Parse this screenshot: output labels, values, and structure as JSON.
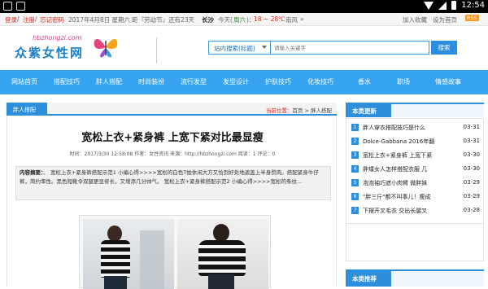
{
  "statusbar": {
    "time": "12:54"
  },
  "topbar": {
    "login": "登录",
    "sep1": " / ",
    "register": "注册",
    "sep2": " / ",
    "forgot": "忘记密码",
    "date": "2017年4月8日 星期六",
    "holiday_prefix": "距『劳动节』还有23天",
    "city": "长沙",
    "weather_today": "今天(",
    "weather_desc": "周六",
    "weather_close": ")：",
    "temp": "18 ~ 28℃",
    "wind": "南风",
    "more": "»",
    "add_fav": "加入收藏",
    "set_home": "设为首页",
    "rss": "RSS"
  },
  "header": {
    "logo_text": "众紫女性网",
    "logo_url": "hbzhongzi.com",
    "search_scope": "站内搜索(标题)",
    "search_placeholder": "请输入关键字",
    "search_button": "搜索"
  },
  "nav": {
    "items": [
      "网站首页",
      "搭配技巧",
      "胖人搭配",
      "时尚装扮",
      "流行发型",
      "发型设计",
      "护肤技巧",
      "化妆技巧",
      "香水",
      "职场",
      "情感故事"
    ]
  },
  "breadcrumb": {
    "tab": "胖人搭配",
    "label": "当前位置：",
    "path": "首页 > 胖人搭配"
  },
  "article": {
    "title": "宽松上衣+紧身裤 上宽下紧对比最显瘦",
    "meta": "时间：2017/3/30 12:58:08  作者：女性资讯  来源：http://hbzhongzi.com  阅读：1  评论：0",
    "summary_label": "内容摘要：",
    "summary_text": "、          宽松上衣+紧身裤搭配示范1        小编心得>>>>宽松的白色T恤休闲大方又恰到好处地遮盖上半身赘肉。搭配紧身牛仔裤，简约率性。黑色短靴令双腿更显修长，又增添几分帅气。          宽松上衣+紧身裤搭配示范2        小编心得>>>>宽松的条纹..."
  },
  "sidebar": {
    "section_title": "本类更新",
    "items": [
      {
        "num": "1",
        "title": "胖人穿衣搭配技巧是什么",
        "date": "03-31"
      },
      {
        "num": "2",
        "title": "Dolce-Gabbana 2016年翻",
        "date": "03-31"
      },
      {
        "num": "3",
        "title": "宽松上衣+紧身裤 上宽下紧",
        "date": "03-30"
      },
      {
        "num": "4",
        "title": "胖矮女人怎样搭配衣服 几",
        "date": "03-30"
      },
      {
        "num": "5",
        "title": "泡泡袖巧遮小肉臂 微胖妹",
        "date": "03-29"
      },
      {
        "num": "6",
        "title": "\"胖三斤\"都不叫事儿！瘦成",
        "date": "03-29"
      },
      {
        "num": "7",
        "title": "下摆开叉毛衣 交出长腿叉",
        "date": "03-28"
      }
    ],
    "section2_title": "本类推荐"
  }
}
